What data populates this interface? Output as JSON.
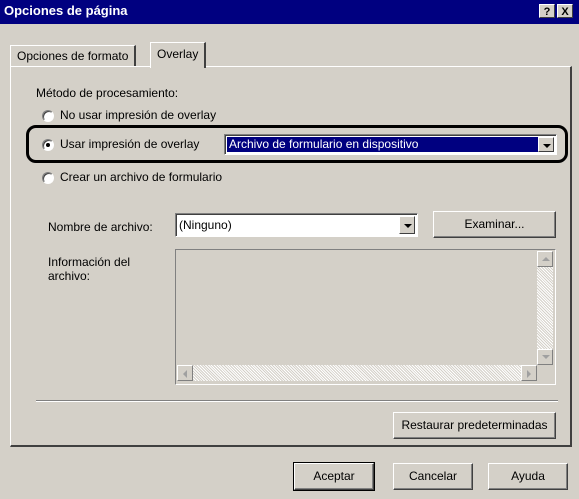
{
  "window": {
    "title": "Opciones de página",
    "help_button": "?",
    "close_button": "X"
  },
  "tabs": [
    {
      "label": "Opciones de formato",
      "active": false
    },
    {
      "label": "Overlay",
      "active": true
    }
  ],
  "processing": {
    "label": "Método de procesamiento:",
    "options": [
      {
        "label": "No usar impresión de overlay",
        "selected": false
      },
      {
        "label": "Usar impresión de overlay",
        "selected": true
      },
      {
        "label": "Crear un archivo de formulario",
        "selected": false
      }
    ],
    "mode_select_value": "Archivo de formulario en dispositivo"
  },
  "file": {
    "name_label": "Nombre de archivo:",
    "name_value": "(Ninguno)",
    "browse_button": "Examinar...",
    "info_label_line1": "Información del",
    "info_label_line2": "archivo:",
    "info_text": ""
  },
  "restore_button": "Restaurar predeterminadas",
  "footer": {
    "ok_button": "Aceptar",
    "cancel_button": "Cancelar",
    "help_button": "Ayuda"
  },
  "colors": {
    "titlebar": "#000080",
    "face": "#d4d0c8",
    "selection": "#000080"
  }
}
